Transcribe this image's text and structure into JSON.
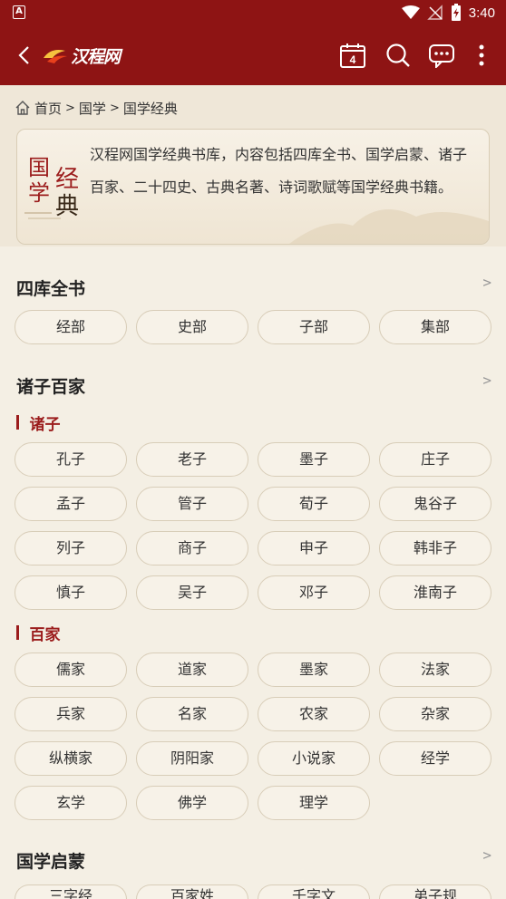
{
  "statusbar": {
    "time": "3:40",
    "notification_icon": "A"
  },
  "appbar": {
    "logo_text": "汉程网"
  },
  "breadcrumb": {
    "home": "首页",
    "sep1": ">",
    "level2": "国学",
    "sep2": ">",
    "level3": "国学经典"
  },
  "intro": {
    "seal_chars": [
      "国",
      "经",
      "学",
      "典"
    ],
    "description": "汉程网国学经典书库，内容包括四库全书、国学启蒙、诸子百家、二十四史、古典名著、诗词歌赋等国学经典书籍。"
  },
  "sections": {
    "siku": {
      "title": "四库全书",
      "more": ">",
      "items": [
        "经部",
        "史部",
        "子部",
        "集部"
      ]
    },
    "zhuzi": {
      "title": "诸子百家",
      "more": ">",
      "sub1": {
        "title": "诸子",
        "items": [
          "孔子",
          "老子",
          "墨子",
          "庄子",
          "孟子",
          "管子",
          "荀子",
          "鬼谷子",
          "列子",
          "商子",
          "申子",
          "韩非子",
          "慎子",
          "吴子",
          "邓子",
          "淮南子"
        ]
      },
      "sub2": {
        "title": "百家",
        "items": [
          "儒家",
          "道家",
          "墨家",
          "法家",
          "兵家",
          "名家",
          "农家",
          "杂家",
          "纵横家",
          "阴阳家",
          "小说家",
          "经学",
          "玄学",
          "佛学",
          "理学"
        ]
      }
    },
    "qimeng": {
      "title": "国学启蒙",
      "more": ">",
      "items": [
        "三字经",
        "百家姓",
        "千字文",
        "弟子规"
      ]
    }
  },
  "colors": {
    "brand": "#8e1414",
    "accent": "#9b1c1c",
    "background": "#f4efe4",
    "pill_border": "#d8cdb8"
  }
}
